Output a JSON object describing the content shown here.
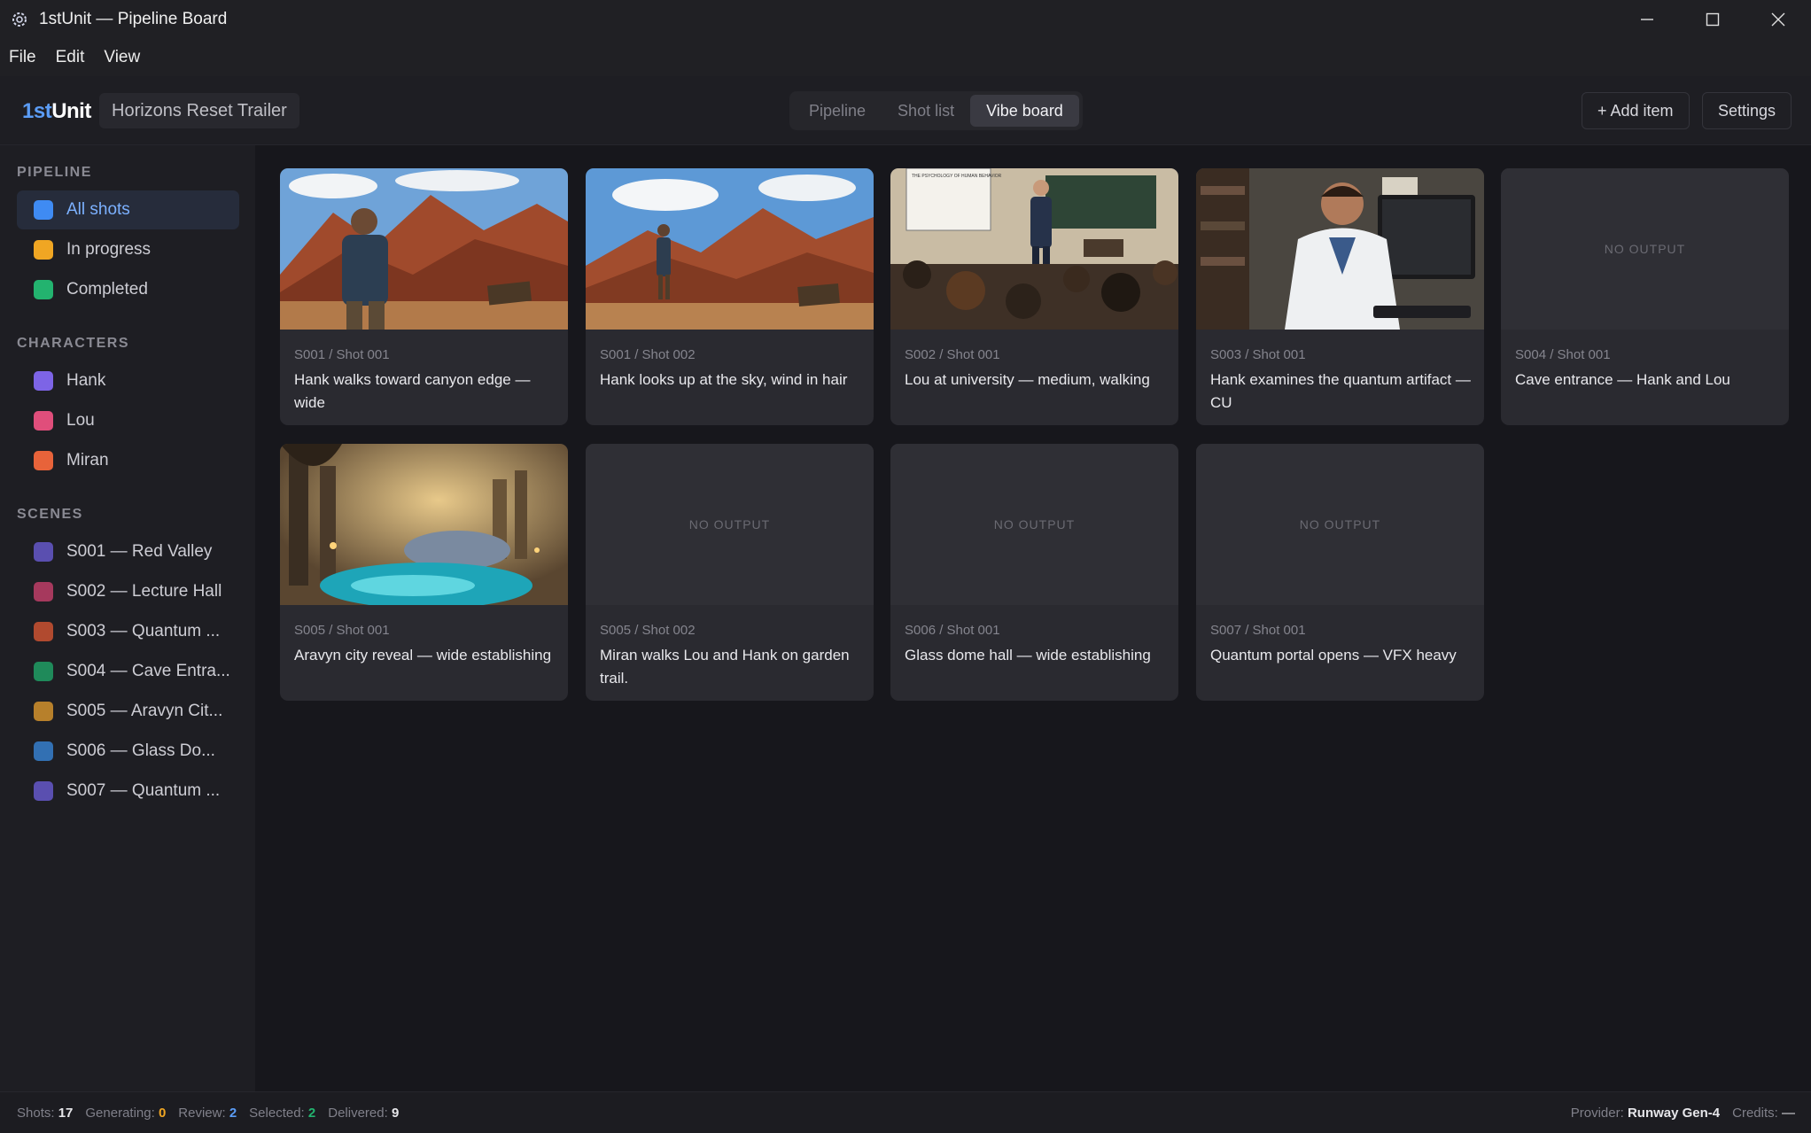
{
  "window": {
    "title": "1stUnit — Pipeline Board"
  },
  "menu": [
    "File",
    "Edit",
    "View"
  ],
  "header": {
    "logo_prefix": "1st",
    "logo_suffix": "Unit",
    "project": "Horizons Reset Trailer",
    "tabs": [
      "Pipeline",
      "Shot list",
      "Vibe board"
    ],
    "active_tab": "Vibe board",
    "add_label": "+ Add item",
    "settings_label": "Settings"
  },
  "sidebar": {
    "pipeline_title": "PIPELINE",
    "pipeline": [
      {
        "label": "All shots",
        "color": "#3f8bf3"
      },
      {
        "label": "In progress",
        "color": "#f0a623"
      },
      {
        "label": "Completed",
        "color": "#23b36f"
      }
    ],
    "characters_title": "CHARACTERS",
    "characters": [
      {
        "label": "Hank",
        "color": "#7d64e6"
      },
      {
        "label": "Lou",
        "color": "#e04e7b"
      },
      {
        "label": "Miran",
        "color": "#e8633a"
      }
    ],
    "scenes_title": "SCENES",
    "scenes": [
      {
        "label": "S001 — Red Valley",
        "color": "#5a4fb0"
      },
      {
        "label": "S002 — Lecture Hall",
        "color": "#a6395d"
      },
      {
        "label": "S003 — Quantum ...",
        "color": "#b14a2f"
      },
      {
        "label": "S004 — Cave Entra...",
        "color": "#1f8a5a"
      },
      {
        "label": "S005 — Aravyn Cit...",
        "color": "#b7802b"
      },
      {
        "label": "S006 — Glass Do...",
        "color": "#3270b3"
      },
      {
        "label": "S007 — Quantum ...",
        "color": "#5a4fb0"
      }
    ]
  },
  "board": {
    "no_output_label": "NO OUTPUT",
    "cards": [
      {
        "code": "S001 / Shot 001",
        "desc": "Hank walks toward canyon edge — wide",
        "thumb": "canyon-hank-wide"
      },
      {
        "code": "S001 / Shot 002",
        "desc": "Hank looks up at the sky, wind in hair",
        "thumb": "canyon-hank-sky"
      },
      {
        "code": "S002 / Shot 001",
        "desc": "Lou at university — medium, walking",
        "thumb": "lecture-hall",
        "slide_text": "THE PSYCHOLOGY OF HUMAN BEHAVIOR"
      },
      {
        "code": "S003 / Shot 001",
        "desc": "Hank examines the quantum artifact — CU",
        "thumb": "lab-office"
      },
      {
        "code": "S004 / Shot 001",
        "desc": "Cave entrance — Hank and Lou",
        "thumb": "none"
      },
      {
        "code": "S005 / Shot 001",
        "desc": "Aravyn city reveal — wide establishing",
        "thumb": "aravyn-city"
      },
      {
        "code": "S005 / Shot 002",
        "desc": "Miran walks Lou and Hank on garden trail.",
        "thumb": "none"
      },
      {
        "code": "S006 / Shot 001",
        "desc": "Glass dome hall — wide establishing",
        "thumb": "none"
      },
      {
        "code": "S007 / Shot 001",
        "desc": "Quantum portal opens — VFX heavy",
        "thumb": "none"
      }
    ]
  },
  "status": {
    "shots_label": "Shots:",
    "shots": "17",
    "generating_label": "Generating:",
    "generating": "0",
    "review_label": "Review:",
    "review": "2",
    "selected_label": "Selected:",
    "selected": "2",
    "delivered_label": "Delivered:",
    "delivered": "9",
    "provider_label": "Provider:",
    "provider": "Runway Gen-4",
    "credits_label": "Credits:",
    "credits": "—"
  },
  "colors": {
    "accent": "#5b9cf5",
    "generating": "#f0a623",
    "review": "#5b9cf5",
    "selected": "#23b36f",
    "delivered": "#e6e6ea"
  }
}
